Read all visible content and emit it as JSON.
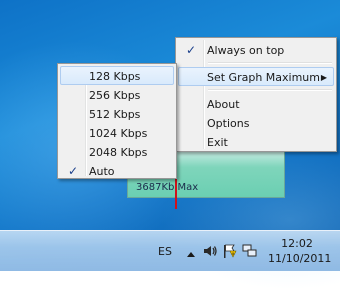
{
  "graph": {
    "label": "3687Kb Max"
  },
  "context_menu": {
    "items": [
      {
        "label": "Always on top",
        "checked": "✓"
      },
      {
        "label": "Set Graph Maximum",
        "arrow": "▶"
      },
      {
        "label": "About"
      },
      {
        "label": "Options"
      },
      {
        "label": "Exit"
      }
    ]
  },
  "submenu": {
    "items": [
      {
        "label": "128 Kbps"
      },
      {
        "label": "256 Kbps"
      },
      {
        "label": "512 Kbps"
      },
      {
        "label": "1024 Kbps"
      },
      {
        "label": "2048 Kbps"
      },
      {
        "label": "Auto",
        "checked": "✓"
      }
    ]
  },
  "taskbar": {
    "language": "ES",
    "time": "12:02",
    "date": "11/10/2011"
  },
  "colors": {
    "desktop": "#1477c9",
    "graph": "#6bcfb2",
    "graph_bar": "#d0121b",
    "menu_bg": "#f0f0f0",
    "highlight": "#d9eafc"
  }
}
